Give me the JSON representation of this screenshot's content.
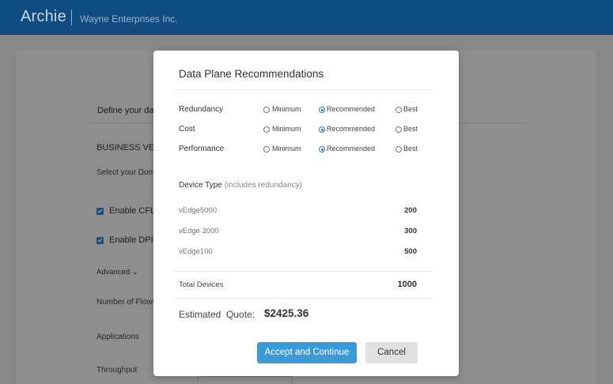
{
  "header": {
    "app_name": "Archie",
    "org_name": "Wayne Enterprises Inc."
  },
  "background_page": {
    "step_label": "Define your data",
    "section_heading": "BUSINESS VER",
    "section_sub": "Select your Dom",
    "checkboxes": [
      {
        "label": "Enable CFL",
        "checked": true
      },
      {
        "label": "Enable DPI",
        "checked": true
      }
    ],
    "advanced_label": "Advanced",
    "fields": [
      "Number of Flows",
      "Applications",
      "Throughput"
    ]
  },
  "modal": {
    "title": "Data Plane Recommendations",
    "options": [
      {
        "label": "Redundancy",
        "choices": [
          "Minimum",
          "Recommended",
          "Best"
        ],
        "selected": "Recommended"
      },
      {
        "label": "Cost",
        "choices": [
          "Minimum",
          "Recommended",
          "Best"
        ],
        "selected": "Recommended"
      },
      {
        "label": "Performance",
        "choices": [
          "Minimum",
          "Recommended",
          "Best"
        ],
        "selected": "Recommended"
      }
    ],
    "device_section_title": "Device Type",
    "device_section_note": "(includes redundancy)",
    "devices": [
      {
        "name": "vEdge5000",
        "count": "200"
      },
      {
        "name": "vEdge 2000",
        "count": "300"
      },
      {
        "name": "vEdge100",
        "count": "500"
      }
    ],
    "total_label": "Total Devices",
    "total_value": "1000",
    "quote_label": "Estimated  Quote:",
    "quote_value": "$2425.36",
    "accept_button": "Accept and Continue",
    "cancel_button": "Cancel"
  },
  "colors": {
    "header_bg": "#0f4c81",
    "primary_button": "#3c9ad6",
    "secondary_button": "#e1e1e1",
    "radio_selected": "#2b7fc2"
  }
}
